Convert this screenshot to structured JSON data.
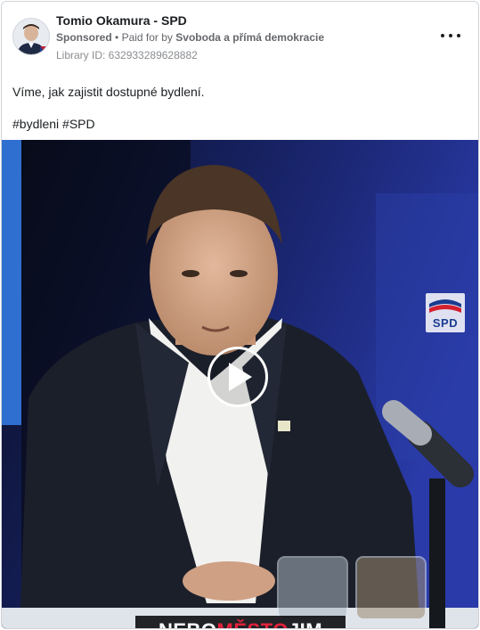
{
  "post": {
    "page_name": "Tomio Okamura - SPD",
    "sponsored_label": "Sponsored",
    "paid_prefix": "Paid for by",
    "paid_by": "Svoboda a přímá demokracie",
    "library_id": "Library ID: 632933289628882",
    "more_icon": "more-horizontal-icon",
    "text": "Víme, jak zajistit dostupné bydlení.",
    "hashtags": "#bydleni #SPD"
  },
  "video": {
    "caption_part1": "NEBO",
    "caption_highlight": "MĚSTO",
    "caption_part2": "JIM",
    "caption_highlight_color": "#e3233d",
    "logo_text": "SPD",
    "play_icon": "play-icon"
  }
}
